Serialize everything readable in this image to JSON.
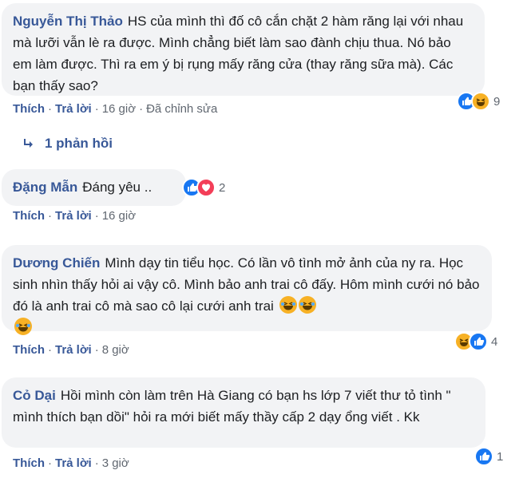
{
  "comments": [
    {
      "author": "Nguyễn Thị Thảo",
      "text": "HS của mình thì đố cô cắn chặt 2 hàm răng lại với nhau mà lưỡi vẫn lè ra được. Mình chẳng biết làm sao đành chịu thua. Nó bảo em làm được. Thì ra em ý bị rụng mấy răng cửa (thay răng sữa mà). Các bạn thấy sao?",
      "like_label": "Thích",
      "reply_label": "Trả lời",
      "time": "16 giờ",
      "edited": "Đã chỉnh sửa",
      "reaction_count": "9",
      "reactions": [
        "like-icon",
        "haha-icon"
      ]
    },
    {
      "author": "Đặng Mẫn",
      "text": "Đáng yêu ..",
      "like_label": "Thích",
      "reply_label": "Trả lời",
      "time": "16 giờ",
      "reaction_count": "2",
      "reactions": [
        "like-icon",
        "love-icon"
      ]
    },
    {
      "author": "Dương Chiến",
      "text": "Mình dạy tin tiểu học. Có lần vô tình mở ảnh của ny ra. Học sinh nhìn thấy hỏi ai vậy cô. Mình bảo anh trai cô đấy. Hôm mình cưới nó bảo đó là anh trai cô mà sao cô lại cưới anh trai",
      "like_label": "Thích",
      "reply_label": "Trả lời",
      "time": "8 giờ",
      "reaction_count": "4",
      "reactions": [
        "haha-icon",
        "like-icon"
      ]
    },
    {
      "author": "Cỏ Dại",
      "text": "Hồi mình còn làm trên Hà Giang có bạn hs lớp 7 viết thư tỏ tình \" mình thích bạn dồi\" hỏi ra mới biết mấy thầy cấp 2 dạy ổng viết . Kk",
      "like_label": "Thích",
      "reply_label": "Trả lời",
      "time": "3 giờ",
      "reaction_count": "1",
      "reactions": [
        "like-icon"
      ]
    }
  ],
  "replies_link": "1 phản hồi",
  "colors": {
    "link": "#385898",
    "bubble": "#f2f3f5",
    "meta": "#606770",
    "like": "#1877f2",
    "haha": "#f7b125",
    "love": "#f33e58"
  }
}
